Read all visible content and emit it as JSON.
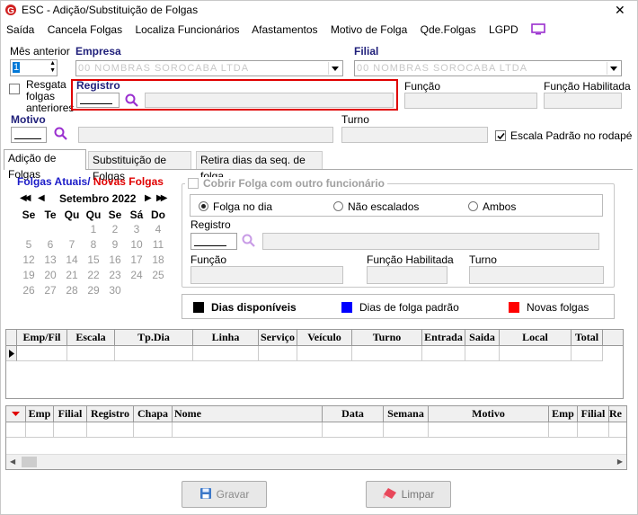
{
  "window": {
    "title": "ESC  -  Adição/Substituição de Folgas",
    "close": "✕"
  },
  "menu": [
    "Saída",
    "Cancela Folgas",
    "Localiza Funcionários",
    "Afastamentos",
    "Motivo de Folga",
    "Qde.Folgas",
    "LGPD"
  ],
  "top": {
    "mes_anterior_label": "Mês anterior",
    "mes_anterior_value": "1",
    "empresa_label": "Empresa",
    "empresa_value": "00 NOMBRAS SOROCABA LTDA",
    "filial_label": "Filial",
    "filial_value": "00 NOMBRAS SOROCABA LTDA",
    "resgata_label": "Resgata folgas anteriores",
    "registro_label": "Registro",
    "funcao_label": "Função",
    "funcao_hab_label": "Função Habilitada",
    "motivo_label": "Motivo",
    "turno_label": "Turno",
    "escala_label": "Escala Padrão no rodapé",
    "escala_checked": true
  },
  "tabs": [
    "Adição de Folgas",
    "Substituição de Folgas",
    "Retira dias da seq. de folga"
  ],
  "calendar": {
    "title_part1": "Folgas Atuais/",
    "title_part2": " Novas Folgas",
    "month": "Setembro 2022",
    "weekdays": [
      "Se",
      "Te",
      "Qu",
      "Qu",
      "Se",
      "Sá",
      "Do"
    ],
    "weeks": [
      [
        "",
        "",
        "",
        "1",
        "2",
        "3",
        "4"
      ],
      [
        "5",
        "6",
        "7",
        "8",
        "9",
        "10",
        "11"
      ],
      [
        "12",
        "13",
        "14",
        "15",
        "16",
        "17",
        "18"
      ],
      [
        "19",
        "20",
        "21",
        "22",
        "23",
        "24",
        "25"
      ],
      [
        "26",
        "27",
        "28",
        "29",
        "30",
        "",
        ""
      ]
    ]
  },
  "cobrir": {
    "label": "Cobrir Folga com outro funcionário",
    "radio_folga": "Folga no dia",
    "radio_nao": "Não escalados",
    "radio_ambos": "Ambos",
    "registro_label": "Registro",
    "funcao_label": "Função",
    "funcao_hab_label": "Função Habilitada",
    "turno_label": "Turno"
  },
  "legend": {
    "disponiveis": "Dias disponíveis",
    "padrao": "Dias de folga padrão",
    "novas": "Novas folgas",
    "colors": [
      "#000000",
      "#0000ff",
      "#ff0000"
    ]
  },
  "grid1": {
    "columns": [
      "Emp/Fil",
      "Escala",
      "Tp.Dia",
      "Linha",
      "Serviço",
      "Veículo",
      "Turno",
      "Entrada",
      "Saida",
      "Local",
      "Total"
    ]
  },
  "grid2": {
    "columns": [
      "Emp",
      "Filial",
      "Registro",
      "Chapa",
      "Nome",
      "Data",
      "Semana",
      "Motivo",
      "Emp",
      "Filial",
      "Re"
    ]
  },
  "buttons": {
    "gravar": "Gravar",
    "limpar": "Limpar"
  }
}
